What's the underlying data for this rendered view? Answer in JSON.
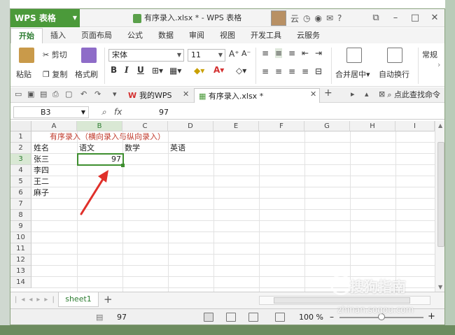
{
  "app": {
    "name": "WPS 表格",
    "doc_title": "有序录入.xlsx * - WPS 表格",
    "user_label": "云"
  },
  "ribbon_tabs": [
    "开始",
    "插入",
    "页面布局",
    "公式",
    "数据",
    "审阅",
    "视图",
    "开发工具",
    "云服务"
  ],
  "ribbon": {
    "paste": "粘贴",
    "cut": "剪切",
    "copy": "复制",
    "format_painter": "格式刷",
    "font_name": "宋体",
    "font_size": "11",
    "bold": "B",
    "italic": "I",
    "underline": "U",
    "merge_center": "合并居中",
    "wrap_text": "自动换行",
    "number_format": "常规"
  },
  "doc_tabs": {
    "my_wps": "我的WPS",
    "file_tab": "有序录入.xlsx *",
    "search_cmd": "点此查找命令"
  },
  "formula_bar": {
    "cell_ref": "B3",
    "fx": "fx",
    "value": "97"
  },
  "columns": [
    "A",
    "B",
    "C",
    "D",
    "E",
    "F",
    "G",
    "H",
    "I"
  ],
  "rows": [
    "1",
    "2",
    "3",
    "4",
    "5",
    "6",
    "7",
    "8",
    "9",
    "10",
    "11",
    "12",
    "13",
    "14"
  ],
  "cells": {
    "title": "有序录入（横向录入与纵向录入）",
    "header_name": "姓名",
    "header_chinese": "语文",
    "header_math": "数学",
    "header_english": "英语",
    "row3_name": "张三",
    "row3_chinese": "97",
    "row4_name": "李四",
    "row5_name": "王二",
    "row6_name": "麻子"
  },
  "sheets": [
    "sheet1"
  ],
  "status": {
    "value": "97",
    "zoom": "100 %",
    "zoom_fraction": 0.5
  },
  "watermark": {
    "brand": "搜狗指南",
    "url": "zhinan.sogou.com"
  },
  "colors": {
    "accent": "#4b9a3a",
    "annotation_red": "#e0302a",
    "title_red": "#c0392b"
  }
}
